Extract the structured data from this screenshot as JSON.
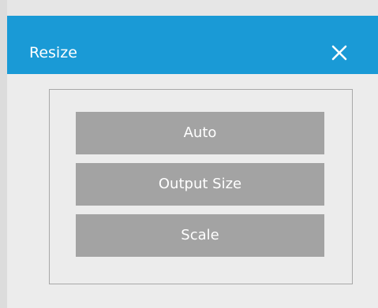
{
  "dialog": {
    "title": "Resize",
    "close_label": "✕",
    "colors": {
      "titlebar": "#1a9ad6",
      "button": "#a3a3a3",
      "panel_border": "#a8a8a8",
      "background": "#ececec"
    }
  },
  "options": {
    "auto_label": "Auto",
    "output_size_label": "Output Size",
    "scale_label": "Scale"
  },
  "icons": {
    "close": "close-icon"
  }
}
